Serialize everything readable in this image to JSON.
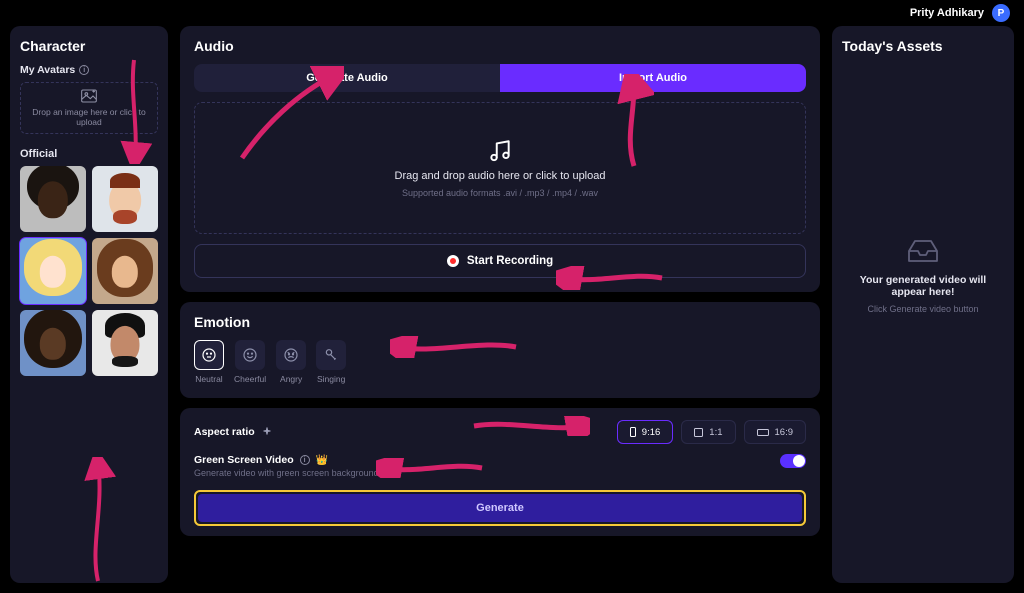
{
  "user": {
    "name": "Prity Adhikary",
    "initial": "P"
  },
  "sidebar": {
    "title": "Character",
    "my_avatars_label": "My Avatars",
    "dropzone_text": "Drop an image here or click to upload",
    "official_label": "Official",
    "avatars": [
      {
        "name": "avatar-1"
      },
      {
        "name": "avatar-2"
      },
      {
        "name": "avatar-3",
        "selected": true
      },
      {
        "name": "avatar-4"
      },
      {
        "name": "avatar-5"
      },
      {
        "name": "avatar-6"
      }
    ]
  },
  "audio": {
    "title": "Audio",
    "tabs": {
      "generate": "Generate Audio",
      "import": "Import Audio",
      "active": "import"
    },
    "drop": {
      "headline": "Drag and drop audio here or click to upload",
      "sub": "Supported audio formats .avi / .mp3 / .mp4 / .wav"
    },
    "record_label": "Start Recording"
  },
  "emotion": {
    "title": "Emotion",
    "items": [
      {
        "key": "neutral",
        "label": "Neutral",
        "selected": true
      },
      {
        "key": "cheerful",
        "label": "Cheerful",
        "selected": false
      },
      {
        "key": "angry",
        "label": "Angry",
        "selected": false
      },
      {
        "key": "singing",
        "label": "Singing",
        "selected": false
      }
    ]
  },
  "settings": {
    "aspect_label": "Aspect ratio",
    "aspect": {
      "options": [
        {
          "key": "9:16",
          "label": "9:16",
          "selected": true
        },
        {
          "key": "1:1",
          "label": "1:1",
          "selected": false
        },
        {
          "key": "16:9",
          "label": "16:9",
          "selected": false
        }
      ]
    },
    "greenscreen": {
      "title": "Green Screen Video",
      "desc": "Generate video with green screen background",
      "on": true
    },
    "generate_label": "Generate"
  },
  "assets": {
    "title": "Today's Assets",
    "empty_headline": "Your generated video will appear here!",
    "empty_sub": "Click Generate video button"
  }
}
